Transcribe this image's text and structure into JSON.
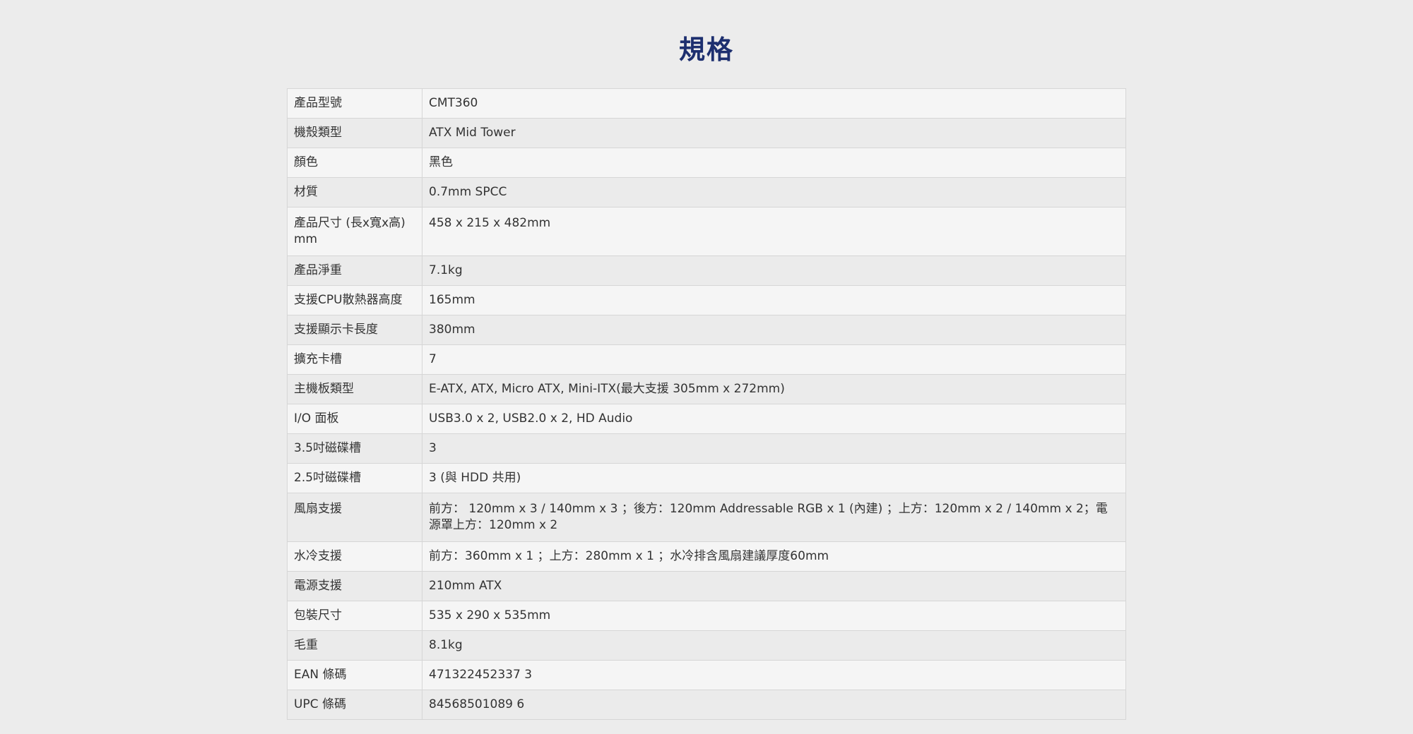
{
  "page": {
    "title": "規格"
  },
  "specs": [
    {
      "label": "產品型號",
      "value": "CMT360"
    },
    {
      "label": "機殼類型",
      "value": "ATX Mid Tower"
    },
    {
      "label": "顏色",
      "value": "黑色"
    },
    {
      "label": "材質",
      "value": "0.7mm SPCC"
    },
    {
      "label": "產品尺寸 (長x寬x高) mm",
      "value": "458 x 215 x 482mm"
    },
    {
      "label": "產品淨重",
      "value": "7.1kg"
    },
    {
      "label": "支援CPU散熱器高度",
      "value": "165mm"
    },
    {
      "label": "支援顯示卡長度",
      "value": "380mm"
    },
    {
      "label": "擴充卡槽",
      "value": "7"
    },
    {
      "label": "主機板類型",
      "value": "E-ATX, ATX, Micro ATX, Mini-ITX(最大支援 305mm x 272mm)"
    },
    {
      "label": "I/O 面板",
      "value": "USB3.0 x 2, USB2.0 x 2, HD Audio"
    },
    {
      "label": "3.5吋磁碟槽",
      "value": "3"
    },
    {
      "label": "2.5吋磁碟槽",
      "value": "3 (與 HDD 共用)"
    },
    {
      "label": "風扇支援",
      "value": "前方： 120mm x 3 / 140mm x 3 ；後方：120mm Addressable RGB x 1 (內建) ；上方：120mm x 2 / 140mm x 2；電源罩上方：120mm x 2"
    },
    {
      "label": "水冷支援",
      "value": "前方：360mm x 1 ；上方：280mm x 1 ；水冷排含風扇建議厚度60mm"
    },
    {
      "label": "電源支援",
      "value": "210mm ATX"
    },
    {
      "label": "包裝尺寸",
      "value": "535 x 290 x 535mm"
    },
    {
      "label": "毛重",
      "value": "8.1kg"
    },
    {
      "label": "EAN 條碼",
      "value": "471322452337 3"
    },
    {
      "label": "UPC 條碼",
      "value": "84568501089 6"
    }
  ]
}
